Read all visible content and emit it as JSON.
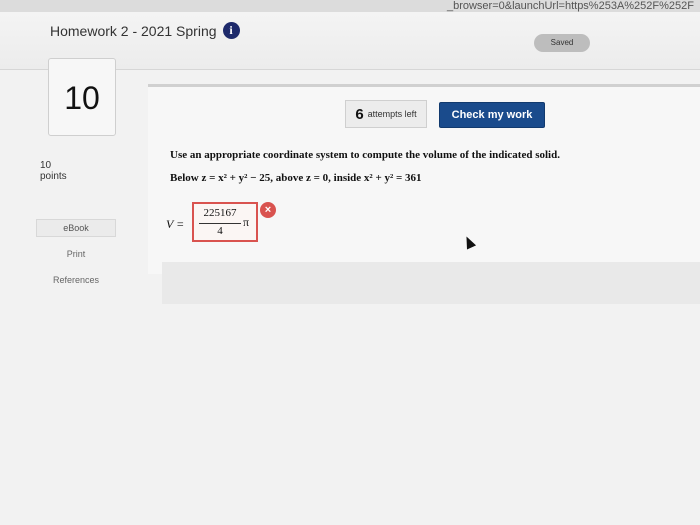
{
  "browser": {
    "url_fragment": "_browser=0&launchUrl=https%253A%252F%252F"
  },
  "header": {
    "title": "Homework 2 - 2021 Spring",
    "info_icon": "i",
    "saved_label": "Saved"
  },
  "question": {
    "number": "10",
    "points_value": "10",
    "points_label": "points",
    "attempts_count": "6",
    "attempts_label": "attempts left",
    "check_label": "Check my work",
    "instruction": "Use an appropriate coordinate system to compute the volume of the indicated solid.",
    "problem": "Below z = x² + y² − 25, above z = 0, inside x² + y² = 361",
    "answer_var": "V =",
    "answer_numerator": "225167",
    "answer_denominator": "4",
    "answer_suffix": "π",
    "answer_status": "×",
    "answer_status_name": "incorrect"
  },
  "sidebar": {
    "ebook_label": "eBook",
    "print_label": "Print",
    "references_label": "References"
  },
  "colors": {
    "check_button": "#1a4b8c",
    "wrong": "#d9534f",
    "info": "#1e2a6b"
  }
}
